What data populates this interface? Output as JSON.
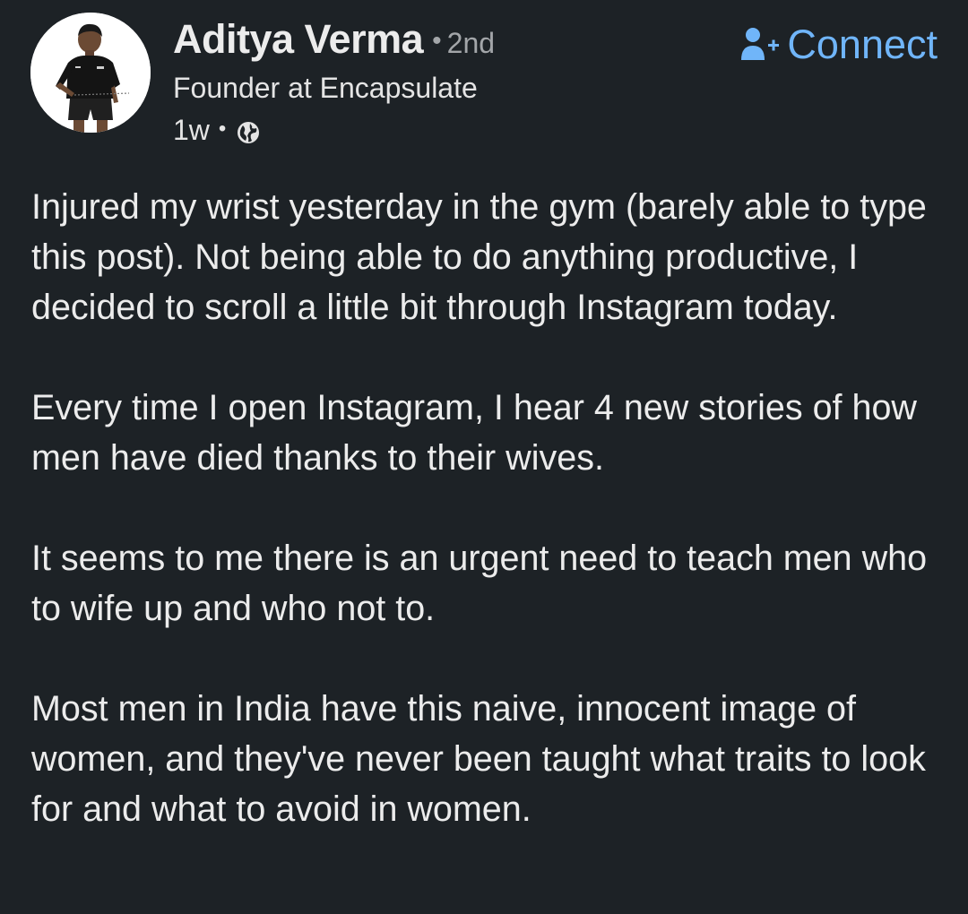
{
  "post": {
    "author": {
      "name": "Aditya Verma",
      "degree": "2nd",
      "headline": "Founder at Encapsulate",
      "avatar_icon": "profile-photo"
    },
    "time_ago": "1w",
    "visibility_icon": "globe-icon",
    "connect_label": "Connect",
    "connect_icon": "add-person-icon",
    "paragraphs": [
      "Injured my wrist yesterday in the gym (barely able to type this post). Not being able to do anything productive, I decided to scroll a little bit through Instagram today.",
      "Every time I open Instagram, I hear 4 new stories of how men have died thanks to their wives.",
      "It seems to me there is an urgent need to teach men who to wife up and who not to.",
      "Most men in India have this naive, innocent image of women, and they've never been taught what traits to look for and what to avoid in women."
    ]
  },
  "colors": {
    "background": "#1d2226",
    "accent": "#70b5f9",
    "text": "#ececec",
    "muted": "#a3a6a9"
  }
}
